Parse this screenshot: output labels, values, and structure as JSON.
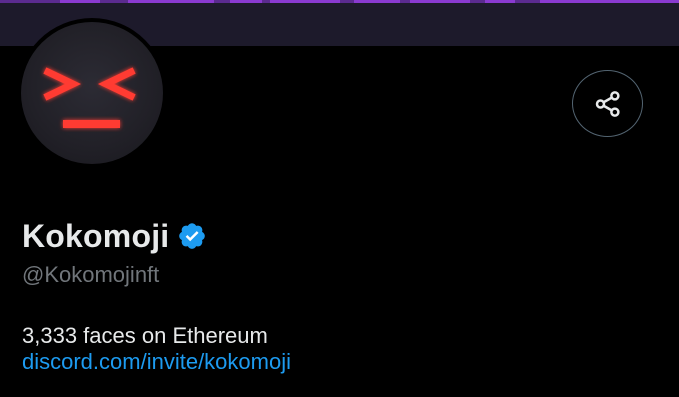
{
  "profile": {
    "display_name": "Kokomoji",
    "handle": "@Kokomojinft",
    "bio": "3,333 faces on Ethereum",
    "link": "discord.com/invite/kokomoji",
    "verified": true
  },
  "icons": {
    "share": "share-icon",
    "verified": "verified-badge-icon",
    "avatar": "kokomoji-face-avatar"
  },
  "colors": {
    "background": "#000000",
    "banner": "#1d1a2b",
    "banner_accent": "#8a3ad0",
    "primary_text": "#e7e9ea",
    "secondary_text": "#71767b",
    "link": "#1d9bf0",
    "verified": "#1d9bf0",
    "avatar_face": "#ff3b30"
  }
}
